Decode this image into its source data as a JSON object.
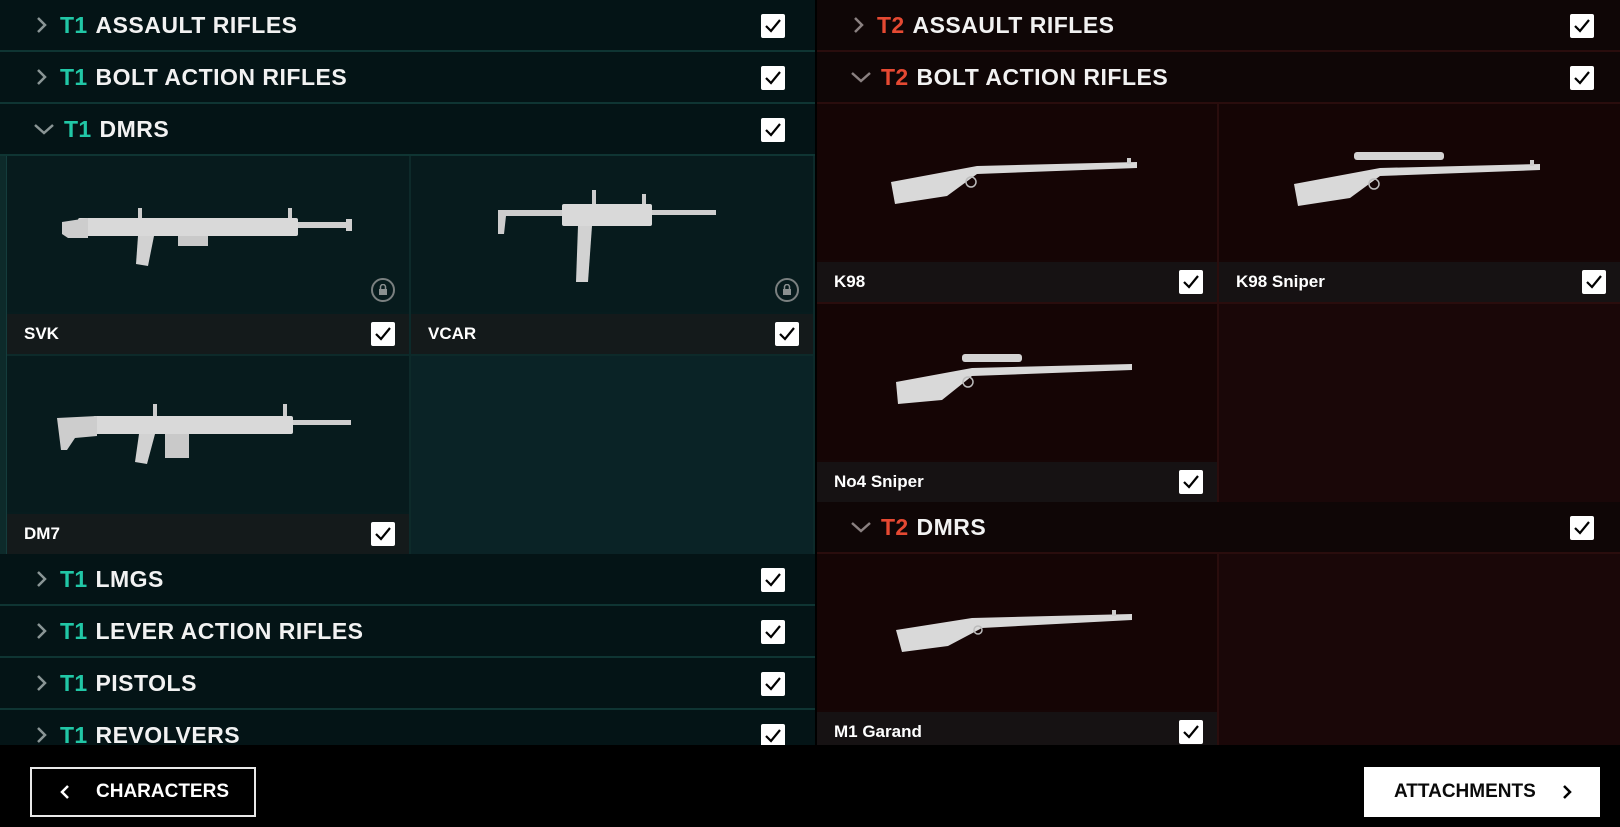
{
  "left_panel": {
    "categories_top": [
      {
        "tier": "T1",
        "title": "ASSAULT RIFLES",
        "checked": true
      },
      {
        "tier": "T1",
        "title": "BOLT ACTION RIFLES",
        "checked": true
      }
    ],
    "open_category": {
      "tier": "T1",
      "title": "DMRS",
      "checked": true
    },
    "weapons": [
      {
        "name": "SVK",
        "checked": true,
        "locked": true
      },
      {
        "name": "VCAR",
        "checked": true,
        "locked": true
      },
      {
        "name": "DM7",
        "checked": true,
        "locked": false
      }
    ],
    "categories_bottom": [
      {
        "tier": "T1",
        "title": "LMGS",
        "checked": true
      },
      {
        "tier": "T1",
        "title": "LEVER ACTION RIFLES",
        "checked": true
      },
      {
        "tier": "T1",
        "title": "PISTOLS",
        "checked": true
      },
      {
        "tier": "T1",
        "title": "REVOLVERS",
        "checked": true
      }
    ]
  },
  "right_panel": {
    "categories_top": [
      {
        "tier": "T2",
        "title": "ASSAULT RIFLES",
        "checked": true
      }
    ],
    "open_category_1": {
      "tier": "T2",
      "title": "BOLT ACTION RIFLES",
      "checked": true
    },
    "weapons_1": [
      {
        "name": "K98",
        "checked": true
      },
      {
        "name": "K98 Sniper",
        "checked": true
      },
      {
        "name": "No4 Sniper",
        "checked": true
      }
    ],
    "open_category_2": {
      "tier": "T2",
      "title": "DMRS",
      "checked": true
    },
    "weapons_2": [
      {
        "name": "M1 Garand",
        "checked": true
      }
    ]
  },
  "footer": {
    "back_label": "CHARACTERS",
    "next_label": "ATTACHMENTS"
  },
  "colors": {
    "t1_accent": "#21c7a6",
    "t2_accent": "#e54932"
  },
  "icons": [
    "chevron-right-icon",
    "chevron-down-icon",
    "checkmark-icon",
    "lock-icon",
    "chevron-left-icon"
  ]
}
